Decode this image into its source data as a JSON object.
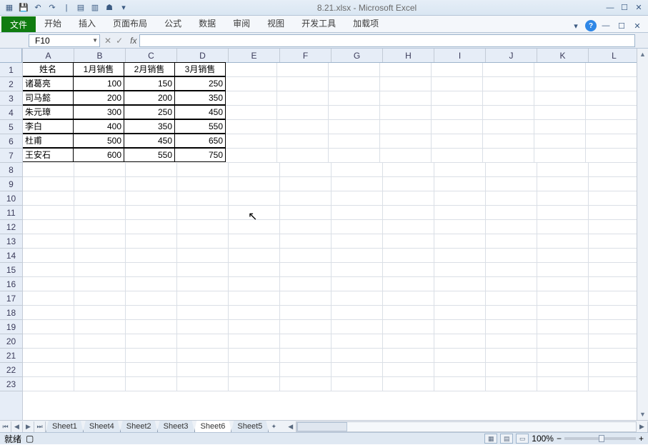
{
  "title": "8.21.xlsx - Microsoft Excel",
  "qat_icons": [
    "excel-icon",
    "save-icon",
    "undo-icon",
    "redo-icon",
    "divider",
    "new-icon",
    "open-icon",
    "print-icon",
    "more-icon"
  ],
  "win_icons": [
    "minimize-icon",
    "restore-icon",
    "close-icon"
  ],
  "ribbon": {
    "file": "文件",
    "tabs": [
      "开始",
      "插入",
      "页面布局",
      "公式",
      "数据",
      "审阅",
      "视图",
      "开发工具",
      "加载项"
    ]
  },
  "ribbon_right_icons": [
    "help-dropdown-icon",
    "help-icon",
    "minimize-ribbon-icon",
    "restore-window-icon",
    "close-window-icon"
  ],
  "namebox": "F10",
  "fx_label": "fx",
  "formula": "",
  "columns": [
    "A",
    "B",
    "C",
    "D",
    "E",
    "F",
    "G",
    "H",
    "I",
    "J",
    "K",
    "L"
  ],
  "row_count": 23,
  "table": {
    "headers": [
      "姓名",
      "1月销售",
      "2月销售",
      "3月销售"
    ],
    "rows": [
      {
        "name": "诸葛亮",
        "v": [
          100,
          150,
          250
        ]
      },
      {
        "name": "司马懿",
        "v": [
          200,
          200,
          350
        ]
      },
      {
        "name": "朱元璋",
        "v": [
          300,
          250,
          450
        ]
      },
      {
        "name": "李白",
        "v": [
          400,
          350,
          550
        ]
      },
      {
        "name": "杜甫",
        "v": [
          500,
          450,
          650
        ]
      },
      {
        "name": "王安石",
        "v": [
          600,
          550,
          750
        ]
      }
    ]
  },
  "sheet_tabs": [
    "Sheet1",
    "Sheet4",
    "Sheet2",
    "Sheet3",
    "Sheet6",
    "Sheet5"
  ],
  "active_sheet": 4,
  "status": {
    "ready": "就绪",
    "zoom": "100%"
  }
}
